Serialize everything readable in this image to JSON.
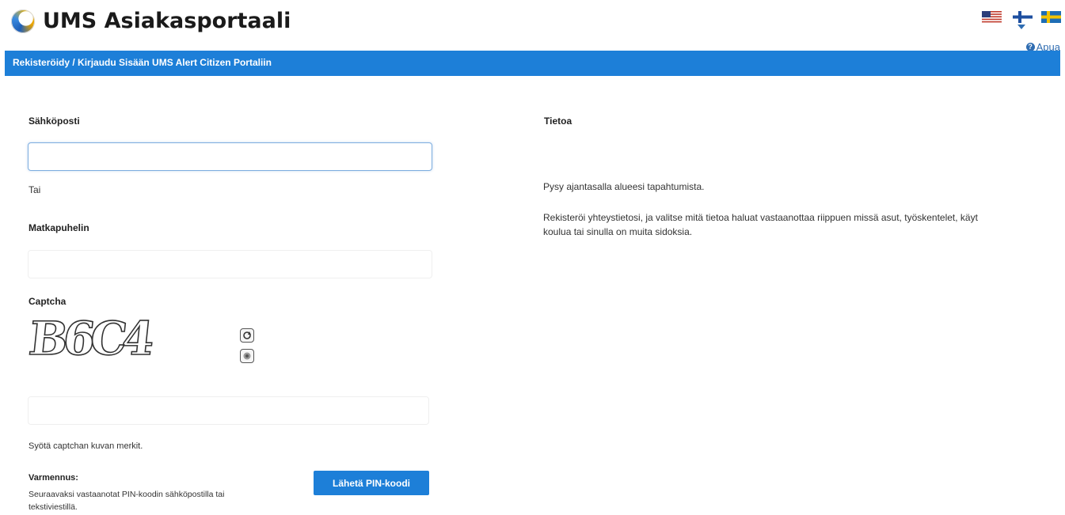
{
  "header": {
    "title": "UMS Asiakasportaali",
    "logo_icon": "ums-globe-logo",
    "languages": [
      {
        "name": "english-flag-icon"
      },
      {
        "name": "finnish-flag-icon"
      },
      {
        "name": "swedish-flag-icon"
      }
    ],
    "help_label": "Apua"
  },
  "breadcrumb": "Rekisteröidy / Kirjaudu Sisään UMS Alert Citizen Portaliin",
  "form": {
    "email_label": "Sähköposti",
    "email_value": "",
    "or_text": "Tai",
    "phone_label": "Matkapuhelin",
    "phone_value": "",
    "captcha_label": "Captcha",
    "captcha_text": "B6C4",
    "captcha_value": "",
    "captcha_hint": "Syötä captchan kuvan merkit.",
    "verification_title": "Varmennus:",
    "verification_text": "Seuraavaksi vastaanotat PIN-koodin sähköpostilla tai tekstiviestillä.",
    "send_button": "Lähetä PIN-koodi"
  },
  "info": {
    "title": "Tietoa",
    "p1": "Pysy ajantasalla alueesi tapahtumista.",
    "p2": "Rekisteröi yhteystietosi, ja valitse mitä tietoa haluat vastaanottaa riippuen missä asut, työskentelet, käyt koulua tai sinulla on muita sidoksia."
  },
  "colors": {
    "accent": "#1d7fd8",
    "link": "#2f6db2"
  }
}
